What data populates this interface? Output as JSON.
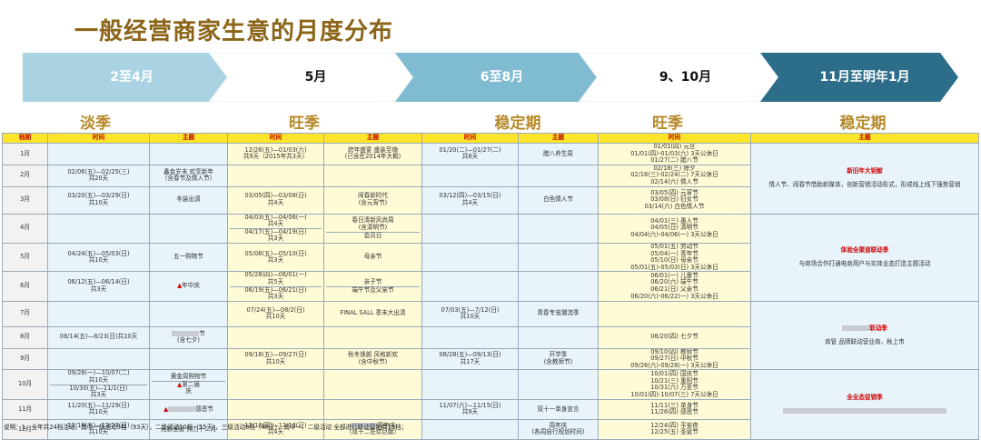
{
  "title": "一般经营商家生意的月度分布",
  "phases": [
    "2至4月",
    "5月",
    "6至8月",
    "9、10月",
    "11月至明年1月"
  ],
  "seasons": [
    "淡季",
    "旺季",
    "稳定期",
    "旺季",
    "稳定期"
  ],
  "colors": {
    "title": "#8b6418",
    "phase1": "#a9d3e3",
    "phase2": "#ffffff",
    "phase3": "#7fbbd1",
    "phase4": "#ffffff",
    "phase5": "#2c6e8a",
    "header_bg": "#ffe52a",
    "header_text": "#c00000"
  },
  "headers": [
    "档期",
    "时间",
    "主题",
    "时间",
    "主题",
    "时间",
    "主题",
    "时间",
    "主题"
  ],
  "months": [
    "1月",
    "2月",
    "3月",
    "4月",
    "5月",
    "6月",
    "7月",
    "8月",
    "9月",
    "10月",
    "11月",
    "12月"
  ],
  "rows": {
    "r1": {
      "t2": "12/26(五)—01/03(六)\n共9天（2015年共3天）",
      "s2": "跨年盛宴 盛装至嗨\n(已含在2014年大概)",
      "t3": "01/20(二)—01/27(二)\n共8天",
      "s3": "腊八养生周",
      "t4": "01/01(四) 元旦\n01/01(四)-01/03(六) 3天公休日\n01/27(二) 腊八节"
    },
    "r2": {
      "t1": "02/06(五)—02/25(三)\n共20天",
      "s1": "鑫金岁末 欢享新年\n（含春节及情人节）",
      "t4": "02/18(三) 除夕\n02/18(三)-02/24(二) 7天公休日\n02/14(六) 情人节"
    },
    "r3": {
      "t2": "03/05(四)—03/08(日)\n共4天",
      "s2": "闹春新时代\n(含元宵节)",
      "t4": "03/05(四) 元宵节\n03/08(日) 妇女节\n03/14(六) 白色情人节"
    },
    "r3b": {
      "t1": "03/20(五)—03/29(日)\n共10天",
      "s1": "冬装出清",
      "t3": "03/12(四)—03/15(日)\n共4天",
      "s3": "白色情人节"
    },
    "r4a": {
      "t2": "04/03(五)—04/06(一)\n共4天",
      "s2": "春日清新风尚周\n(含清明节)",
      "t4": "04/01(三) 愚人节\n04/05(日) 清明节\n04/04(六)-04/06(一) 3天公休日"
    },
    "r4b": {
      "t2": "04/17(五)—04/19(日)\n共3天",
      "s2": "会员日"
    },
    "r5": {
      "t1": "04/24(五)—05/03(日)\n共10天",
      "s1": "五一购物节",
      "t2": "05/08(五)—05/10(日)\n共3天",
      "s2": "母亲节",
      "t4": "05/01(五) 劳动节\n05/04(一) 青年节\n05/10(日) 母亲节\n05/01(五)-05/03(日) 3天公休日"
    },
    "r6a": {
      "t1": "06/12(五)—06/14(日)\n共3天",
      "s1": "年中庆",
      "t2": "05/28(四)—06/01(一)\n共5天",
      "s2": "亲子节",
      "t4": "06/01(一) 儿童节\n06/20(六) 端午节\n06/21(日) 父亲节\n06/20(六)-06/22(一) 3天公休日"
    },
    "r6b": {
      "t2": "06/19(五)—06/21(日)\n共3天",
      "s2": "端午节及父亲节"
    },
    "r7a": {
      "t3": "07/03(五)—7/12(日)\n共10天",
      "s3": "青春专宠潮流季"
    },
    "r7b": {
      "t2": "07/24(五)—08/2(日)\n共10天",
      "s2": "FINAL SALL 季末大出清"
    },
    "r8": {
      "t1": "08/14(五)—8/23(日)共10天",
      "s1": "节\n(含七夕)",
      "t4": "08/20(四) 七夕节"
    },
    "r9": {
      "t2": "09/18(五)—09/27(日)\n共10天",
      "s2": "秋冬焕颜 风格新欢\n(含中秋节)",
      "t3": "08/28(五)—09/13(日)\n共17天",
      "s3": "开学季\n(含教师节)",
      "t4": "09/10(四) 教师节\n09/27(日) 中秋节\n09/26(六)-09/28(一) 3天公休日"
    },
    "r10a": {
      "t1": "09/28(一)—10/07(二)\n共10天",
      "s1": "黄金周购物节",
      "t4": "10/01(四) 国庆节\n10/21(三) 重阳节\n10/31(六) 万圣节\n10/01(四)-10/07(三) 7天公休日"
    },
    "r10b": {
      "t1": "10/30(五)—11/1(日)\n共3天",
      "s1": "第二届\n庆"
    },
    "r11": {
      "t1": "11/20(五)—11/29(日)\n共10天",
      "s1": "感恩节",
      "t3": "11/07(六)—11/15(日)\n共9天",
      "s3": "双十一单身宣言",
      "t4": "11/11(三) 单身节\n11/26(四) 感恩节"
    },
    "r12": {
      "t1": "12/18(五)—12/27(日)\n共10天",
      "s1": "元影圣诞 热力十二月",
      "t2": "12/10(四)—12/13(日)\n共4天",
      "s2": "周年庆\n（双十二狂欢巨献）",
      "s3": "周年庆\n(各周自行规划时间)",
      "t4": "12/24(四) 平安夜\n12/25(五) 圣诞节"
    },
    "right": {
      "h1": "新旧年大钜献",
      "d1": "情人节、闹春节借助新媒体，创新营销活动形式，形成线上线下强势营销",
      "h2": "体验全渠道联动季",
      "d2": "与商场合作打通电商用户与实体业态打造主题活动",
      "h3": "联动季",
      "d3": "商管 品牌联动营业商，秋上市",
      "h4": "全业态促销季"
    }
  },
  "note": "说明：1、全年共24档活动，其中一级活动9档（93天），二级活动10档（55天），三级活动8档（48天），其中一、二级活动 全部进行联动营销共19档；"
}
